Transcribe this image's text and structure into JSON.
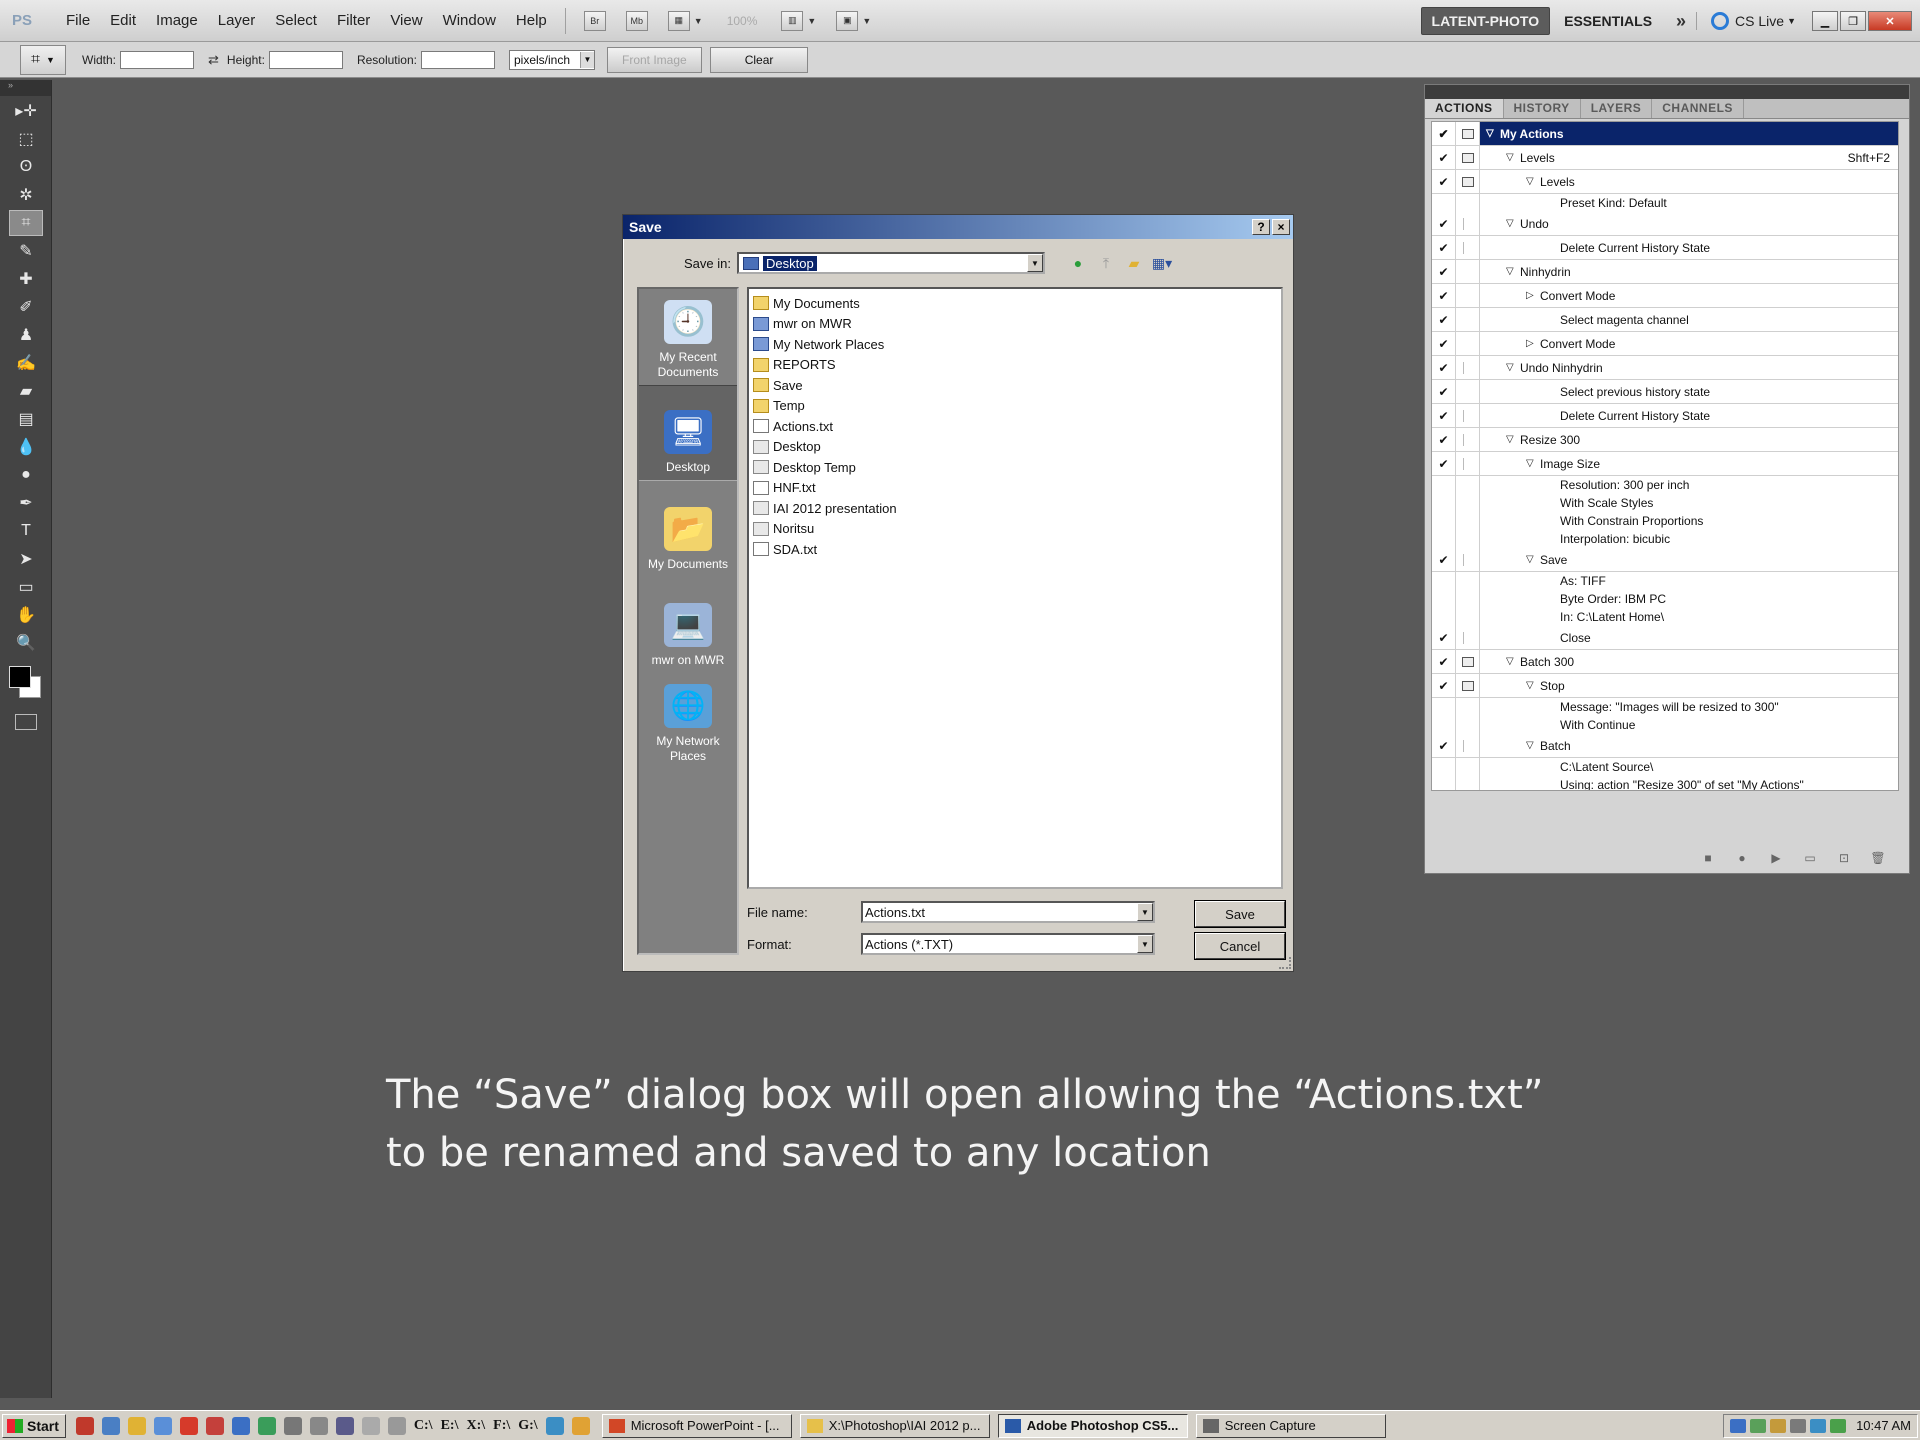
{
  "menubar": {
    "logo": "PS",
    "menus": [
      "File",
      "Edit",
      "Image",
      "Layer",
      "Select",
      "Filter",
      "View",
      "Window",
      "Help"
    ],
    "bridge": "Br",
    "minibridge": "Mb",
    "zoom": "100%",
    "workspace_active": "LATENT-PHOTO",
    "workspace_other": "ESSENTIALS",
    "more": "»",
    "cslive": "CS Live"
  },
  "options": {
    "width_label": "Width:",
    "width_value": "",
    "height_label": "Height:",
    "height_value": "",
    "resolution_label": "Resolution:",
    "resolution_value": "",
    "units": "pixels/inch",
    "front_image": "Front Image",
    "clear": "Clear"
  },
  "tools": [
    "move",
    "marquee",
    "lasso",
    "quick-select",
    "crop",
    "eyedropper",
    "healing",
    "brush",
    "clone-stamp",
    "history-brush",
    "eraser",
    "gradient",
    "blur",
    "dodge",
    "pen",
    "type",
    "path-select",
    "shape",
    "hand",
    "zoom"
  ],
  "actions_panel": {
    "tabs": [
      "ACTIONS",
      "HISTORY",
      "LAYERS",
      "CHANNELS"
    ],
    "rows": [
      {
        "check": true,
        "dialog": "box",
        "indent": 0,
        "tri": "down",
        "label": "My Actions",
        "shortcut": "",
        "selected": true,
        "sub": false
      },
      {
        "check": true,
        "dialog": "box",
        "indent": 1,
        "tri": "down",
        "label": "Levels",
        "shortcut": "Shft+F2",
        "selected": false,
        "sub": false
      },
      {
        "check": true,
        "dialog": "box",
        "indent": 2,
        "tri": "down",
        "label": "Levels",
        "shortcut": "",
        "selected": false,
        "sub": false
      },
      {
        "check": false,
        "dialog": "none",
        "indent": 3,
        "tri": "",
        "label": "Preset Kind: Default",
        "shortcut": "",
        "selected": false,
        "sub": true
      },
      {
        "check": true,
        "dialog": "faint",
        "indent": 1,
        "tri": "down",
        "label": "Undo",
        "shortcut": "",
        "selected": false,
        "sub": false
      },
      {
        "check": true,
        "dialog": "faint",
        "indent": 3,
        "tri": "",
        "label": "Delete Current History State",
        "shortcut": "",
        "selected": false,
        "sub": false
      },
      {
        "check": true,
        "dialog": "none",
        "indent": 1,
        "tri": "down",
        "label": "Ninhydrin",
        "shortcut": "",
        "selected": false,
        "sub": false
      },
      {
        "check": true,
        "dialog": "none",
        "indent": 2,
        "tri": "right",
        "label": "Convert Mode",
        "shortcut": "",
        "selected": false,
        "sub": false
      },
      {
        "check": true,
        "dialog": "none",
        "indent": 3,
        "tri": "",
        "label": "Select magenta channel",
        "shortcut": "",
        "selected": false,
        "sub": false
      },
      {
        "check": true,
        "dialog": "none",
        "indent": 2,
        "tri": "right",
        "label": "Convert Mode",
        "shortcut": "",
        "selected": false,
        "sub": false
      },
      {
        "check": true,
        "dialog": "faint",
        "indent": 1,
        "tri": "down",
        "label": "Undo Ninhydrin",
        "shortcut": "",
        "selected": false,
        "sub": false
      },
      {
        "check": true,
        "dialog": "none",
        "indent": 3,
        "tri": "",
        "label": "Select previous history state",
        "shortcut": "",
        "selected": false,
        "sub": false
      },
      {
        "check": true,
        "dialog": "faint",
        "indent": 3,
        "tri": "",
        "label": "Delete Current History State",
        "shortcut": "",
        "selected": false,
        "sub": false
      },
      {
        "check": true,
        "dialog": "faint",
        "indent": 1,
        "tri": "down",
        "label": "Resize 300",
        "shortcut": "",
        "selected": false,
        "sub": false
      },
      {
        "check": true,
        "dialog": "faint",
        "indent": 2,
        "tri": "down",
        "label": "Image Size",
        "shortcut": "",
        "selected": false,
        "sub": false
      },
      {
        "check": false,
        "dialog": "none",
        "indent": 3,
        "tri": "",
        "label": "Resolution: 300 per inch",
        "shortcut": "",
        "selected": false,
        "sub": true
      },
      {
        "check": false,
        "dialog": "none",
        "indent": 3,
        "tri": "",
        "label": "With Scale Styles",
        "shortcut": "",
        "selected": false,
        "sub": true
      },
      {
        "check": false,
        "dialog": "none",
        "indent": 3,
        "tri": "",
        "label": "With Constrain Proportions",
        "shortcut": "",
        "selected": false,
        "sub": true
      },
      {
        "check": false,
        "dialog": "none",
        "indent": 3,
        "tri": "",
        "label": "Interpolation: bicubic",
        "shortcut": "",
        "selected": false,
        "sub": true
      },
      {
        "check": true,
        "dialog": "faint",
        "indent": 2,
        "tri": "down",
        "label": "Save",
        "shortcut": "",
        "selected": false,
        "sub": false
      },
      {
        "check": false,
        "dialog": "none",
        "indent": 3,
        "tri": "",
        "label": "As: TIFF",
        "shortcut": "",
        "selected": false,
        "sub": true
      },
      {
        "check": false,
        "dialog": "none",
        "indent": 3,
        "tri": "",
        "label": "Byte Order: IBM PC",
        "shortcut": "",
        "selected": false,
        "sub": true
      },
      {
        "check": false,
        "dialog": "none",
        "indent": 3,
        "tri": "",
        "label": "In: C:\\Latent Home\\",
        "shortcut": "",
        "selected": false,
        "sub": true
      },
      {
        "check": true,
        "dialog": "faint",
        "indent": 3,
        "tri": "",
        "label": "Close",
        "shortcut": "",
        "selected": false,
        "sub": false
      },
      {
        "check": true,
        "dialog": "box",
        "indent": 1,
        "tri": "down",
        "label": "Batch 300",
        "shortcut": "",
        "selected": false,
        "sub": false
      },
      {
        "check": true,
        "dialog": "box",
        "indent": 2,
        "tri": "down",
        "label": "Stop",
        "shortcut": "",
        "selected": false,
        "sub": false
      },
      {
        "check": false,
        "dialog": "none",
        "indent": 3,
        "tri": "",
        "label": "Message:  \"Images will be resized to 300\"",
        "shortcut": "",
        "selected": false,
        "sub": true
      },
      {
        "check": false,
        "dialog": "none",
        "indent": 3,
        "tri": "",
        "label": "With Continue",
        "shortcut": "",
        "selected": false,
        "sub": true
      },
      {
        "check": true,
        "dialog": "faint",
        "indent": 2,
        "tri": "down",
        "label": "Batch",
        "shortcut": "",
        "selected": false,
        "sub": false
      },
      {
        "check": false,
        "dialog": "none",
        "indent": 3,
        "tri": "",
        "label": "C:\\Latent Source\\",
        "shortcut": "",
        "selected": false,
        "sub": true
      },
      {
        "check": false,
        "dialog": "none",
        "indent": 3,
        "tri": "",
        "label": "Using: action \"Resize 300\" of set \"My Actions\"",
        "shortcut": "",
        "selected": false,
        "sub": true
      }
    ]
  },
  "save_dialog": {
    "title": "Save",
    "help": "?",
    "close": "×",
    "save_in_label": "Save in:",
    "save_in_value": "Desktop",
    "places": [
      {
        "label": "My Recent Documents",
        "icon": "recent-documents-icon",
        "active": false
      },
      {
        "label": "Desktop",
        "icon": "desktop-icon",
        "active": true
      },
      {
        "label": "My Documents",
        "icon": "my-documents-icon",
        "active": false
      },
      {
        "label": "mwr on MWR",
        "icon": "computer-icon",
        "active": false
      },
      {
        "label": "My Network Places",
        "icon": "network-places-icon",
        "active": false
      }
    ],
    "files": [
      {
        "name": "My Documents",
        "type": "folder"
      },
      {
        "name": "mwr on MWR",
        "type": "sys"
      },
      {
        "name": "My Network Places",
        "type": "sys"
      },
      {
        "name": "REPORTS",
        "type": "folder"
      },
      {
        "name": "Save",
        "type": "folder"
      },
      {
        "name": "Temp",
        "type": "folder"
      },
      {
        "name": "Actions.txt",
        "type": "txt"
      },
      {
        "name": "Desktop",
        "type": "lnk"
      },
      {
        "name": "Desktop Temp",
        "type": "lnk"
      },
      {
        "name": "HNF.txt",
        "type": "txt"
      },
      {
        "name": "IAI 2012 presentation",
        "type": "lnk"
      },
      {
        "name": "Noritsu",
        "type": "lnk"
      },
      {
        "name": "SDA.txt",
        "type": "txt"
      }
    ],
    "file_name_label": "File name:",
    "file_name_value": "Actions.txt",
    "format_label": "Format:",
    "format_value": "Actions (*.TXT)",
    "save_button": "Save",
    "cancel_button": "Cancel"
  },
  "caption": {
    "line1": "The “Save” dialog box will open allowing the “Actions.txt”",
    "line2": "to be renamed and saved to any location"
  },
  "taskbar": {
    "start": "Start",
    "drives": [
      "C:\\",
      "E:\\",
      "X:\\",
      "F:\\",
      "G:\\"
    ],
    "tasks": [
      {
        "label": "Microsoft PowerPoint - [...",
        "active": false,
        "color": "#d24726"
      },
      {
        "label": "X:\\Photoshop\\IAI 2012 p...",
        "active": false,
        "color": "#e6c04a"
      },
      {
        "label": "Adobe Photoshop CS5...",
        "active": true,
        "color": "#2a5aa8"
      },
      {
        "label": "Screen Capture",
        "active": false,
        "color": "#666666"
      }
    ],
    "clock": "10:47 AM"
  }
}
